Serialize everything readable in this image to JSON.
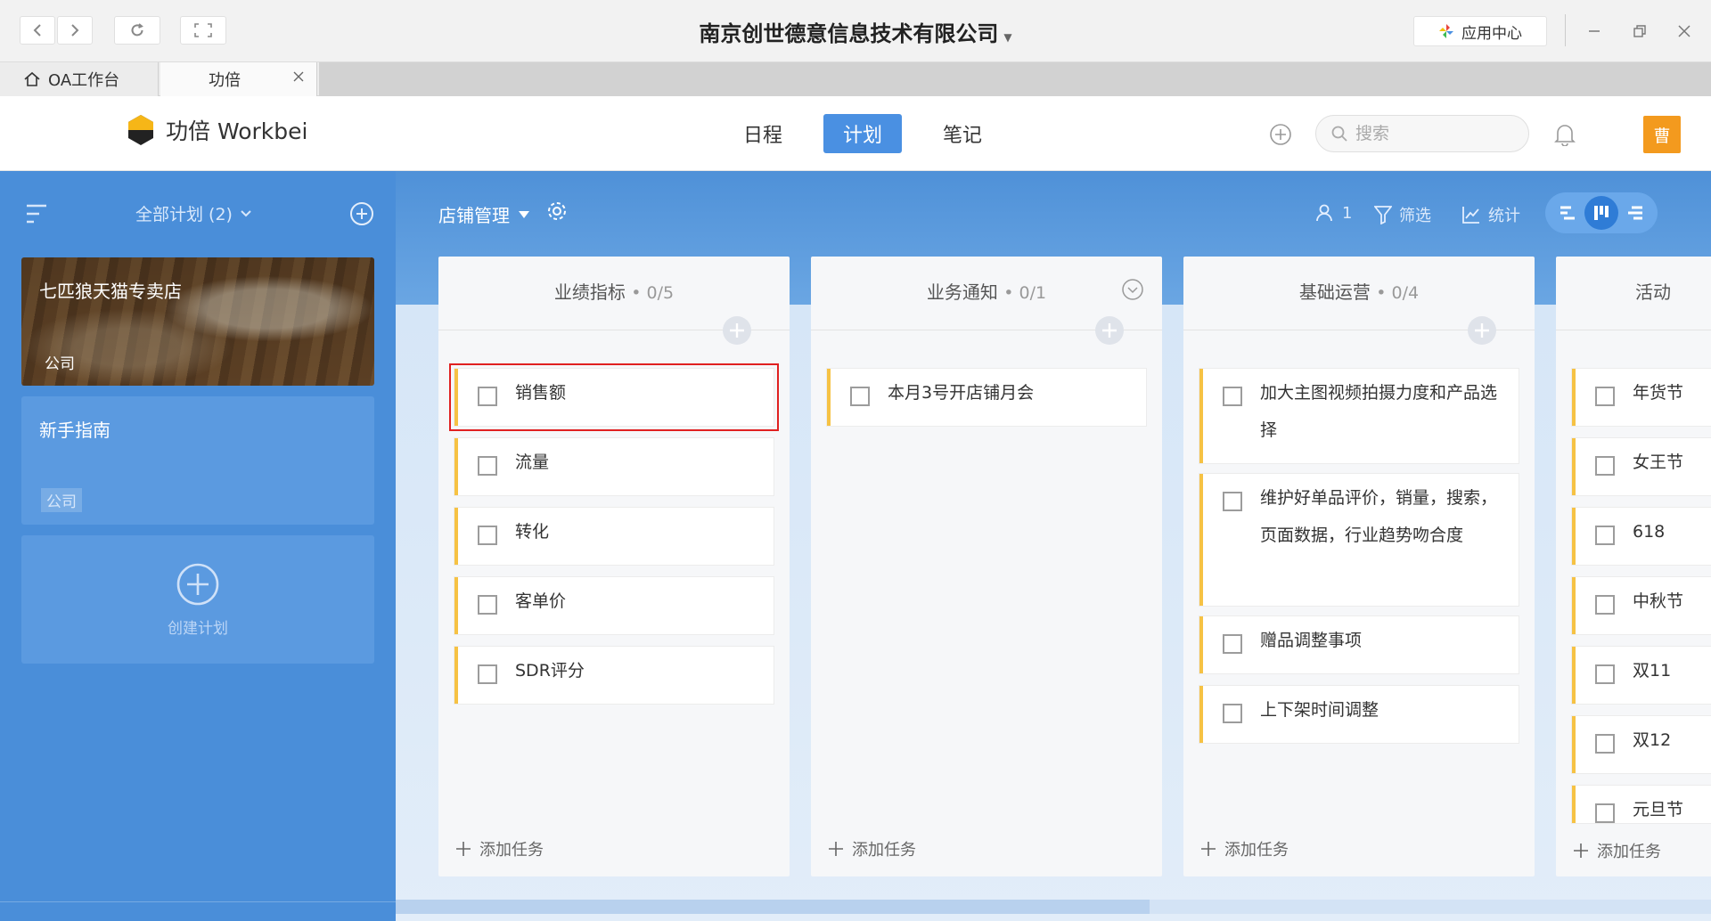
{
  "window": {
    "title": "南京创世德意信息技术有限公司",
    "app_center_label": "应用中心"
  },
  "tabs": [
    {
      "label": "OA工作台"
    },
    {
      "label": "功倍"
    }
  ],
  "header": {
    "logo_text": "功倍 Workbei",
    "nav": [
      {
        "label": "日程",
        "active": false
      },
      {
        "label": "计划",
        "active": true
      },
      {
        "label": "笔记",
        "active": false
      }
    ],
    "search_placeholder": "搜索",
    "avatar_text": "曹"
  },
  "sidebar": {
    "title": "全部计划 (2)",
    "plans": [
      {
        "name": "七匹狼天猫专卖店",
        "type": "公司"
      },
      {
        "name": "新手指南",
        "type": "公司"
      }
    ],
    "create_label": "创建计划"
  },
  "board": {
    "title": "店铺管理",
    "tools": {
      "members_count": "1",
      "filter_label": "筛选",
      "stats_label": "统计"
    },
    "add_task_label": "添加任务",
    "columns": [
      {
        "title": "业绩指标",
        "count": "0/5",
        "tasks": [
          "销售额",
          "流量",
          "转化",
          "客单价",
          "SDR评分"
        ]
      },
      {
        "title": "业务通知",
        "count": "0/1",
        "tasks": [
          "本月3号开店铺月会"
        ]
      },
      {
        "title": "基础运营",
        "count": "0/4",
        "tasks": [
          "加大主图视频拍摄力度和产品选择",
          "维护好单品评价，销量，搜索，页面数据，行业趋势吻合度",
          "赠品调整事项",
          "上下架时间调整"
        ]
      },
      {
        "title": "活动",
        "count": "",
        "tasks": [
          "年货节",
          "女王节",
          "618",
          "中秋节",
          "双11",
          "双12",
          "元旦节"
        ]
      }
    ]
  },
  "colors": {
    "accent": "#4a90e2",
    "sidebar_bg": "#4a8ed9",
    "task_stripe": "#f6c244",
    "avatar_bg": "#f39a1e",
    "highlight": "#e02020"
  }
}
